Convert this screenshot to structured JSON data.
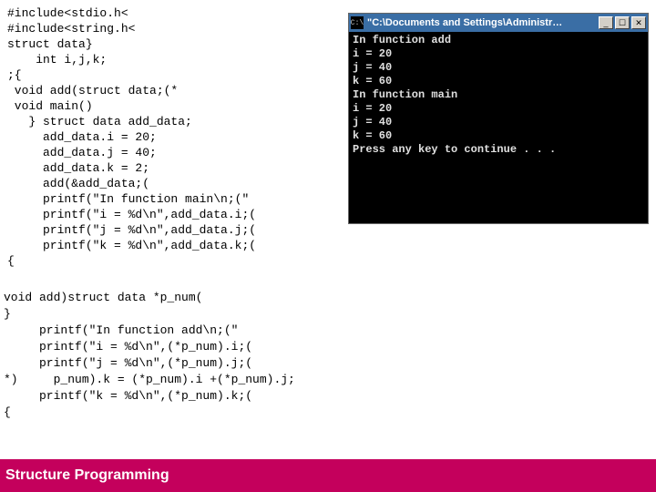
{
  "code1": "#include<stdio.h<\n#include<string.h<\nstruct data}\n    int i,j,k;\n;{\n void add(struct data;(*\n void main()\n   } struct data add_data;\n     add_data.i = 20;\n     add_data.j = 40;\n     add_data.k = 2;\n     add(&add_data;(\n     printf(\"In function main\\n;(\"\n     printf(\"i = %d\\n\",add_data.i;(\n     printf(\"j = %d\\n\",add_data.j;(\n     printf(\"k = %d\\n\",add_data.k;(\n{",
  "code2": "void add)struct data *p_num(\n}\n     printf(\"In function add\\n;(\"\n     printf(\"i = %d\\n\",(*p_num).i;(\n     printf(\"j = %d\\n\",(*p_num).j;(\n*)     p_num).k = (*p_num).i +(*p_num).j;\n     printf(\"k = %d\\n\",(*p_num).k;(\n{",
  "console": {
    "titlebar_icon": "C:\\",
    "title": "\"C:\\Documents and Settings\\Administr…",
    "min": "_",
    "max": "☐",
    "close": "✕",
    "output": "In function add\ni = 20\nj = 40\nk = 60\nIn function main\ni = 20\nj = 40\nk = 60\nPress any key to continue . . ."
  },
  "footer": "Structure Programming"
}
